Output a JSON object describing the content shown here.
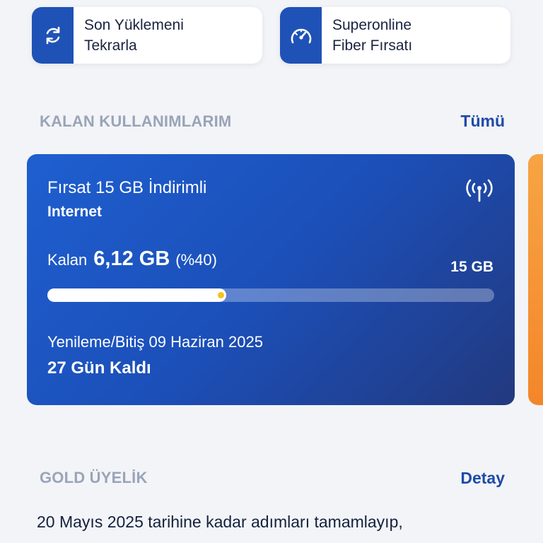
{
  "quick_actions": [
    {
      "label": "Son Yüklemeni\nTekrarla",
      "icon": "refresh-icon"
    },
    {
      "label": "Superonline\nFiber Fırsatı",
      "icon": "speedometer-icon"
    }
  ],
  "remaining_usage": {
    "section_title": "KALAN KULLANIMLARIM",
    "see_all_label": "Tümü"
  },
  "usage_card": {
    "package_name": "Fırsat 15 GB İndirimli",
    "package_type": "Internet",
    "remaining_prefix": "Kalan",
    "remaining_amount": "6,12 GB",
    "remaining_percent": "(%40)",
    "total_amount": "15 GB",
    "progress_fraction": 0.4,
    "renewal_text": "Yenileme/Bitiş 09 Haziran 2025",
    "days_left": "27 Gün Kaldı",
    "icon": "signal-tower-icon",
    "accent_color": "#1e5fd0",
    "dot_color": "#f6c21c"
  },
  "gold_membership": {
    "section_title": "GOLD ÜYELİK",
    "detail_label": "Detay",
    "description": "20 Mayıs 2025 tarihine kadar adımları tamamlayıp,"
  },
  "colors": {
    "brand_blue": "#1f52b6",
    "link_blue": "#1f4aa8",
    "section_gray": "#9aa4b8",
    "peek_card_orange": "#f4862a"
  }
}
